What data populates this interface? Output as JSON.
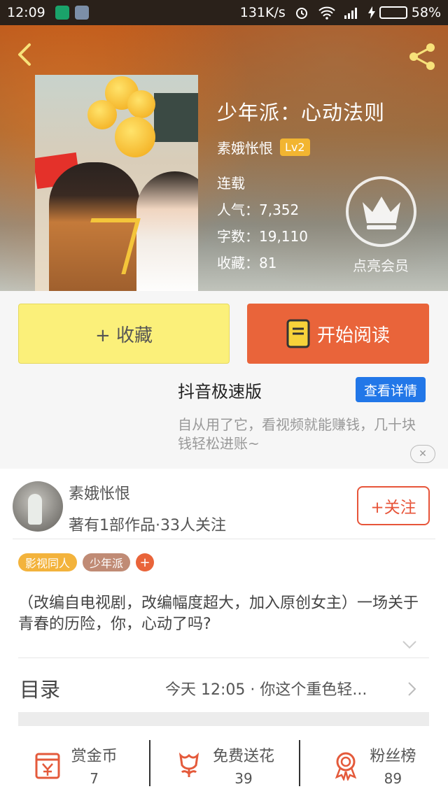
{
  "status_bar": {
    "time": "12:09",
    "network_speed": "131K/s",
    "battery": "58%",
    "battery_level": 0.58
  },
  "book": {
    "title": "少年派：心动法则",
    "author": "素娥怅恨",
    "level": "Lv2",
    "status": "连载",
    "popularity": "人气：7,352",
    "word_count": "字数：19,110",
    "favorites": "收藏：81",
    "vip_label": "点亮会员"
  },
  "actions": {
    "favorite_label": "+ 收藏",
    "read_label": "开始阅读"
  },
  "ad": {
    "title": "抖音极速版",
    "button_label": "查看详情",
    "description": "自从用了它，看视频就能赚钱，几十块钱轻松进账~",
    "close_symbol": "✕"
  },
  "author_card": {
    "name": "素娥怅恨",
    "stats": "著有1部作品·33人关注",
    "follow_label": "+关注"
  },
  "tags": [
    "影视同人",
    "少年派"
  ],
  "tag_add_label": "+",
  "description": "（改编自电视剧，改编幅度超大，加入原创女主）一场关于青春的历险，你，心动了吗?",
  "toc": {
    "label": "目录",
    "latest": "今天 12:05 · 你这个重色轻..."
  },
  "bottom_bar": [
    {
      "label": "赏金币",
      "count": "7",
      "icon": "reward-coin-icon"
    },
    {
      "label": "免费送花",
      "count": "39",
      "icon": "flower-icon"
    },
    {
      "label": "粉丝榜",
      "count": "89",
      "icon": "medal-icon"
    }
  ],
  "colors": {
    "accent": "#e9643a",
    "favorite_button": "#fbf07a",
    "ad_button": "#2277e8",
    "level_badge": "#f2b531"
  }
}
